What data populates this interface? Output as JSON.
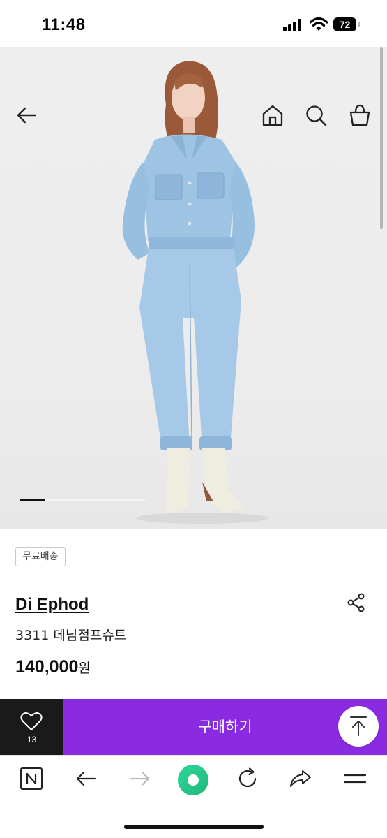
{
  "status_bar": {
    "time": "11:48",
    "battery_level": "72",
    "icons": [
      "signal-icon",
      "wifi-icon",
      "battery-icon"
    ]
  },
  "header": {
    "icons": [
      "back-arrow-icon",
      "home-icon",
      "search-icon",
      "shopping-bag-icon"
    ]
  },
  "hero": {
    "image_alt": "model-in-denim-jumpsuit",
    "carousel_progress": 0.2
  },
  "product": {
    "badge": "무료배송",
    "brand": "Di Ephod",
    "name": "3311 데님점프슈트",
    "price": "140,000",
    "currency": "원"
  },
  "purchase_bar": {
    "like_count": "13",
    "buy_label": "구매하기",
    "accent_color": "#8a2be2",
    "like_bg_color": "#1a1a1a"
  },
  "browser_toolbar": {
    "icons": [
      "naver-n-icon",
      "back-icon",
      "forward-icon",
      "green-dot-icon",
      "refresh-icon",
      "share-arrow-icon",
      "menu-icon"
    ],
    "green_color": "#22c88a"
  }
}
